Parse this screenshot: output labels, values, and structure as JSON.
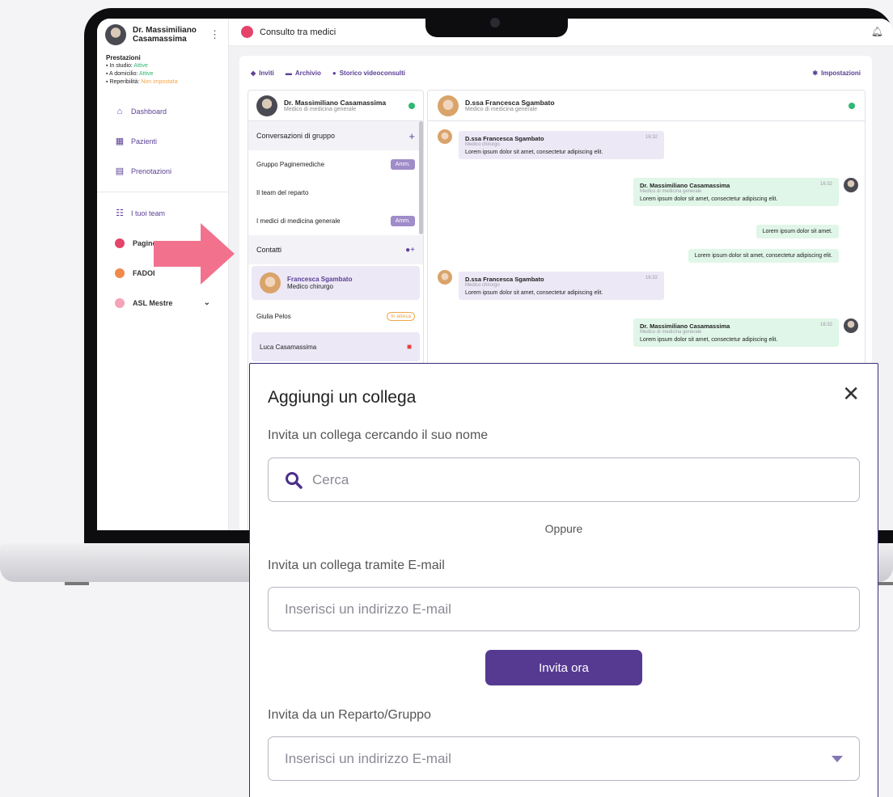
{
  "sidebar": {
    "profile_name": "Dr. Massimiliano Casamassima",
    "prestazioni": {
      "title": "Prestazioni",
      "in_studio_label": "In studio:",
      "in_studio_value": "Attive",
      "domicilio_label": "A domicilio:",
      "domicilio_value": "Attive",
      "reperibilita_label": "Reperibilità:",
      "reperibilita_value": "Non impostata"
    },
    "nav": [
      "Dashboard",
      "Pazienti",
      "Prenotazioni"
    ],
    "teams_label": "I tuoi team",
    "teams": [
      {
        "label": "Pagine",
        "color": "#e5436a"
      },
      {
        "label": "FADOI",
        "color": "#f08a4b"
      },
      {
        "label": "ASL Mestre",
        "color": "#f4a3b8"
      }
    ]
  },
  "topbar": {
    "title": "Consulto tra medici"
  },
  "toolbar": {
    "invites": "Inviti",
    "archive": "Archivio",
    "history": "Storico videoconsulti",
    "settings": "Impostazioni"
  },
  "contacts": {
    "me_name": "Dr. Massimiliano Casamassima",
    "me_role": "Medico di medicina generale",
    "groups_title": "Conversazioni di gruppo",
    "groups": [
      {
        "name": "Gruppo Paginemediche",
        "badge": "Amm."
      },
      {
        "name": "Il team del reparto",
        "badge": ""
      },
      {
        "name": "I medici di medicina generale",
        "badge": "Amm."
      }
    ],
    "contacts_title": "Contatti",
    "list": [
      {
        "name": "Francesca Sgambato",
        "role": "Medico chirurgo"
      },
      {
        "name": "Giulia Pelos",
        "status": "In attesa"
      },
      {
        "name": "Luca Casamassima"
      }
    ]
  },
  "chat": {
    "peer_name": "D.ssa Francesca Sgambato",
    "peer_role": "Medico di medicina generale",
    "messages": [
      {
        "who": "D.ssa Francesca Sgambato",
        "role": "Medico chirurgo",
        "time": "16:32",
        "text": "Lorem ipsum dolor sit amet, consectetur adipiscing elit."
      },
      {
        "who": "Dr. Massimiliano Casamassima",
        "role": "Medico di medicina generale",
        "time": "16:32",
        "text": "Lorem ipsum dolor sit amet, consectetur adipiscing elit."
      },
      {
        "text": "Lorem ipsum dolor sit amet."
      },
      {
        "text": "Lorem ipsum dolor sit amet, consectetur adipiscing elit."
      },
      {
        "who": "D.ssa Francesca Sgambato",
        "role": "Medico chirurgo",
        "time": "16:32",
        "text": "Lorem ipsum dolor sit amet, consectetur adipiscing elit."
      },
      {
        "who": "Dr. Massimiliano Casamassima",
        "role": "Medico di medicina generale",
        "time": "16:32",
        "text": "Lorem ipsum dolor sit amet, consectetur adipiscing elit."
      }
    ]
  },
  "modal": {
    "title": "Aggiungi un collega",
    "search_label": "Invita un collega cercando il suo nome",
    "search_placeholder": "Cerca",
    "or": "Oppure",
    "email_label": "Invita un collega tramite E-mail",
    "email_placeholder": "Inserisci un indirizzo E-mail",
    "invite_button": "Invita ora",
    "group_label": "Invita da un Reparto/Gruppo",
    "group_placeholder": "Inserisci un indirizzo E-mail"
  },
  "colors": {
    "accent": "#563a92",
    "arrow": "#f2728e",
    "online": "#2eb872",
    "danger": "#e54242"
  }
}
